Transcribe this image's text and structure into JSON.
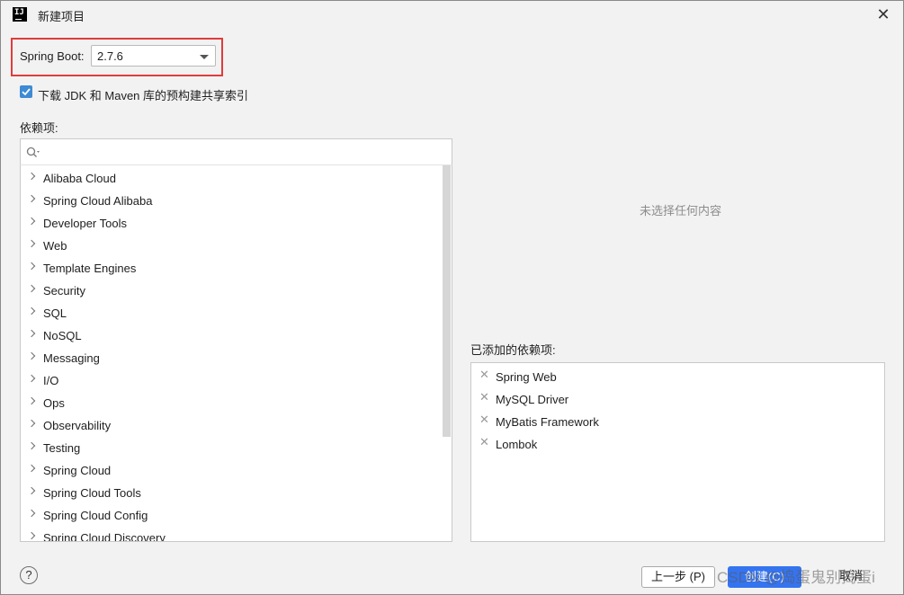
{
  "window": {
    "title": "新建项目",
    "app_icon": "IJ",
    "close": "✕"
  },
  "spring_boot": {
    "label": "Spring Boot:",
    "value": "2.7.6"
  },
  "download_index": {
    "checked": true,
    "label": "下载 JDK 和 Maven 库的预构建共享索引"
  },
  "dependencies": {
    "label": "依赖项:",
    "search_placeholder": "",
    "items": [
      "Alibaba Cloud",
      "Spring Cloud Alibaba",
      "Developer Tools",
      "Web",
      "Template Engines",
      "Security",
      "SQL",
      "NoSQL",
      "Messaging",
      "I/O",
      "Ops",
      "Observability",
      "Testing",
      "Spring Cloud",
      "Spring Cloud Tools",
      "Spring Cloud Config",
      "Spring Cloud Discovery"
    ]
  },
  "details": {
    "empty_text": "未选择任何内容"
  },
  "added": {
    "label": "已添加的依赖项:",
    "items": [
      "Spring Web",
      "MySQL Driver",
      "MyBatis Framework",
      "Lombok"
    ]
  },
  "footer": {
    "help": "?",
    "prev": "上一步 (P)",
    "create": "创建(C)",
    "cancel": "取消"
  },
  "watermark": "CSDN @捣蛋鬼别捣蛋i",
  "colors": {
    "accent": "#3574f0",
    "highlight_border": "#e03c3c"
  }
}
